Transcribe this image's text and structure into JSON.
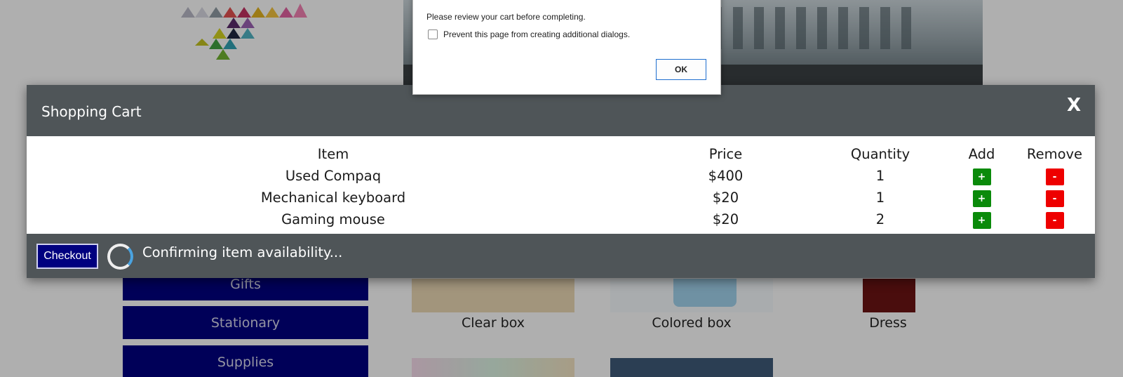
{
  "background": {
    "sidebar": [
      "Gifts",
      "Stationary",
      "Supplies"
    ],
    "products": [
      "Clear box",
      "Colored box",
      "Dress"
    ]
  },
  "dialog": {
    "message": "Please review your cart before completing.",
    "prevent_label": "Prevent this page from creating additional dialogs.",
    "ok_label": "OK"
  },
  "cart": {
    "title": "Shopping Cart",
    "close_label": "X",
    "columns": {
      "item": "Item",
      "price": "Price",
      "quantity": "Quantity",
      "add": "Add",
      "remove": "Remove"
    },
    "rows": [
      {
        "item": "Used Compaq",
        "price": "$400",
        "quantity": "1"
      },
      {
        "item": "Mechanical keyboard",
        "price": "$20",
        "quantity": "1"
      },
      {
        "item": "Gaming mouse",
        "price": "$20",
        "quantity": "2"
      }
    ],
    "add_symbol": "+",
    "remove_symbol": "-",
    "checkout_label": "Checkout",
    "status": "Confirming item availability..."
  },
  "colors": {
    "header_bg": "#4f5558",
    "nav_blue": "#00007f",
    "add_green": "#0a8a0a",
    "remove_red": "#ee0000",
    "spinner_accent": "#4aa3e0"
  }
}
